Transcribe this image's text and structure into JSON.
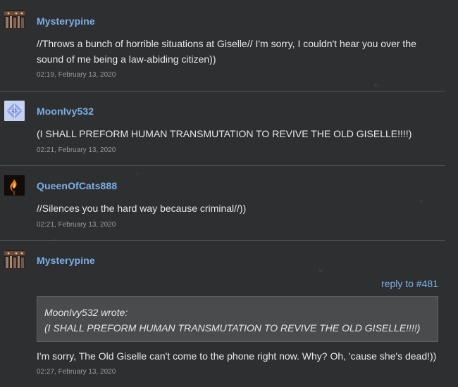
{
  "posts": [
    {
      "username": "Mysterypine",
      "avatar_icon": "mysterypine-avatar",
      "body_lines": [
        "//Throws a bunch of horrible situations at Giselle// I'm sorry, I couldn't hear you over the",
        "sound of me being a law-abiding citizen))"
      ],
      "timestamp": "02:19, February 13, 2020"
    },
    {
      "username": "MoonIvy532",
      "avatar_icon": "moonivy-avatar",
      "body_lines": [
        "(I SHALL PREFORM HUMAN TRANSMUTATION TO REVIVE THE OLD GISELLE!!!!)"
      ],
      "timestamp": "02:21, February 13, 2020"
    },
    {
      "username": "QueenOfCats888",
      "avatar_icon": "queenofcats-avatar",
      "body_lines": [
        "//Silences you the hard way because criminal//))"
      ],
      "timestamp": "02:21, February 13, 2020"
    },
    {
      "username": "Mysterypine",
      "avatar_icon": "mysterypine-avatar",
      "reply_link": "reply to #481",
      "quote": {
        "author_line": "MoonIvy532 wrote:",
        "text": "(I SHALL PREFORM HUMAN TRANSMUTATION TO REVIVE THE OLD GISELLE!!!!)"
      },
      "body_lines": [
        "I'm sorry, The Old Giselle can't come to the phone right now. Why? Oh, 'cause she's dead!))"
      ],
      "timestamp": "02:27, February 13, 2020"
    }
  ],
  "colors": {
    "background": "#2e2f31",
    "username": "#7cb0e6",
    "link": "#7cb0e6",
    "divider": "#55575a",
    "quote_background": "#4a4b4d"
  }
}
